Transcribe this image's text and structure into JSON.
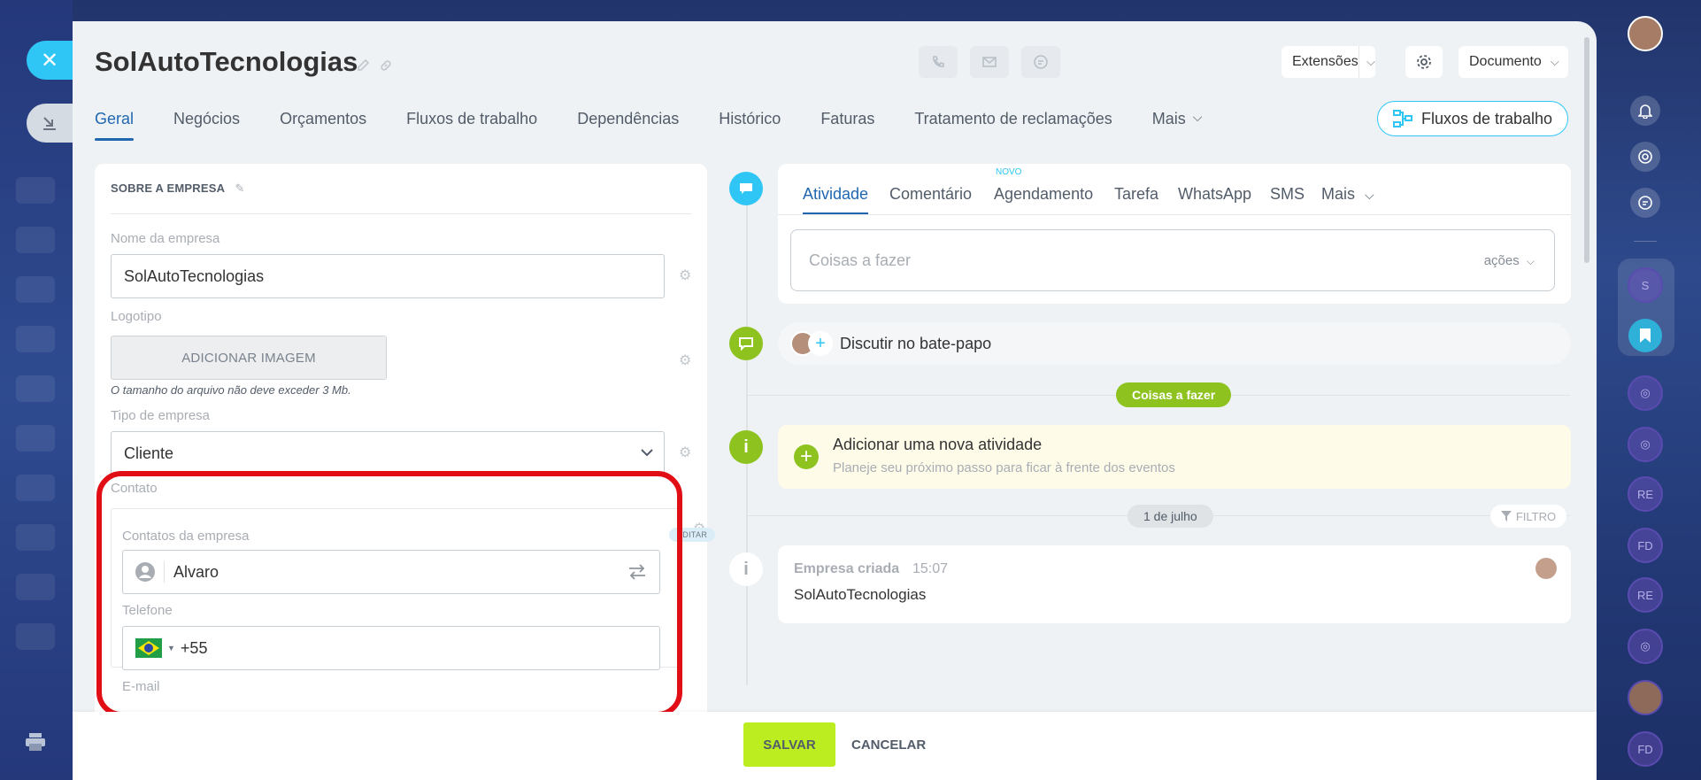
{
  "window": {
    "title": "SolAutoTecnologias",
    "extensions_label": "Extensões",
    "document_label": "Documento"
  },
  "tabs": [
    {
      "label": "Geral"
    },
    {
      "label": "Negócios"
    },
    {
      "label": "Orçamentos"
    },
    {
      "label": "Fluxos de trabalho"
    },
    {
      "label": "Dependências"
    },
    {
      "label": "Histórico"
    },
    {
      "label": "Faturas"
    },
    {
      "label": "Tratamento de reclamações"
    },
    {
      "label": "Mais"
    }
  ],
  "flows_button": "Fluxos de trabalho",
  "company": {
    "section_title": "SOBRE A EMPRESA",
    "name_label": "Nome da empresa",
    "name_value": "SolAutoTecnologias",
    "logo_label": "Logotipo",
    "add_image_label": "ADICIONAR IMAGEM",
    "size_note": "O tamanho do arquivo não deve exceder 3 Mb.",
    "type_label": "Tipo de empresa",
    "type_value": "Cliente",
    "contact_label": "Contato",
    "contacts_label": "Contatos da empresa",
    "edit_badge": "EDITAR",
    "contact_value": "Alvaro",
    "phone_label": "Telefone",
    "phone_value": "+55",
    "email_label": "E-mail"
  },
  "footer": {
    "save_label": "SALVAR",
    "cancel_label": "CANCELAR"
  },
  "activity": {
    "tabs": [
      {
        "label": "Atividade"
      },
      {
        "label": "Comentário"
      },
      {
        "label": "Agendamento"
      },
      {
        "label": "Tarefa"
      },
      {
        "label": "WhatsApp"
      },
      {
        "label": "SMS"
      },
      {
        "label": "Mais"
      }
    ],
    "new_badge": "NOVO",
    "todo_placeholder": "Coisas a fazer",
    "actions_label": "ações"
  },
  "timeline": {
    "chat_label": "Discutir no bate-papo",
    "todo_pill": "Coisas a fazer",
    "new_activity_title": "Adicionar uma nova atividade",
    "new_activity_subtitle": "Planeje seu próximo passo para ficar à frente dos eventos",
    "date_pill": "1 de julho",
    "filter_label": "FILTRO",
    "created_title": "Empresa criada",
    "created_time": "15:07",
    "created_company": "SolAutoTecnologias"
  },
  "sidebar": {
    "circles": [
      "S",
      "RE",
      "FD",
      "RE",
      "FD"
    ]
  },
  "colors": {
    "accent_blue": "#2067b0",
    "cyan": "#2fc6f6",
    "lime": "#bbed21",
    "timeline_green": "#8dc21f",
    "highlight_red": "#e20e16"
  }
}
